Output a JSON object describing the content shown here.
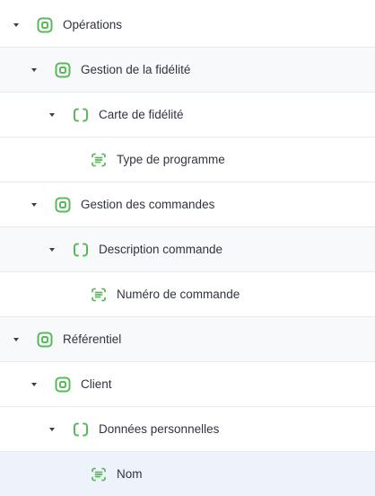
{
  "tree": {
    "rows": [
      {
        "label": "Opérations",
        "level": 0,
        "type": "domain",
        "expanded": true
      },
      {
        "label": "Gestion de la fidélité",
        "level": 1,
        "type": "domain",
        "expanded": true
      },
      {
        "label": "Carte de fidélité",
        "level": 2,
        "type": "object",
        "expanded": true
      },
      {
        "label": "Type de programme",
        "level": 3,
        "type": "attribute"
      },
      {
        "label": "Gestion des commandes",
        "level": 1,
        "type": "domain",
        "expanded": true
      },
      {
        "label": "Description commande",
        "level": 2,
        "type": "object",
        "expanded": true
      },
      {
        "label": "Numéro de commande",
        "level": 3,
        "type": "attribute"
      },
      {
        "label": "Référentiel",
        "level": 0,
        "type": "domain",
        "expanded": true
      },
      {
        "label": "Client",
        "level": 1,
        "type": "domain",
        "expanded": true
      },
      {
        "label": "Données personnelles",
        "level": 2,
        "type": "object",
        "expanded": true
      },
      {
        "label": "Nom",
        "level": 3,
        "type": "attribute",
        "selected": true
      }
    ]
  },
  "colors": {
    "icon_green": "#5cb85c",
    "text": "#2f3440",
    "alt_row": "#f8f9fb",
    "selected_row": "#eef2fb",
    "divider": "#e8eaee"
  },
  "icons": {
    "domain": "rounded-square-icon",
    "object": "bracket-square-icon",
    "attribute": "field-icon"
  }
}
